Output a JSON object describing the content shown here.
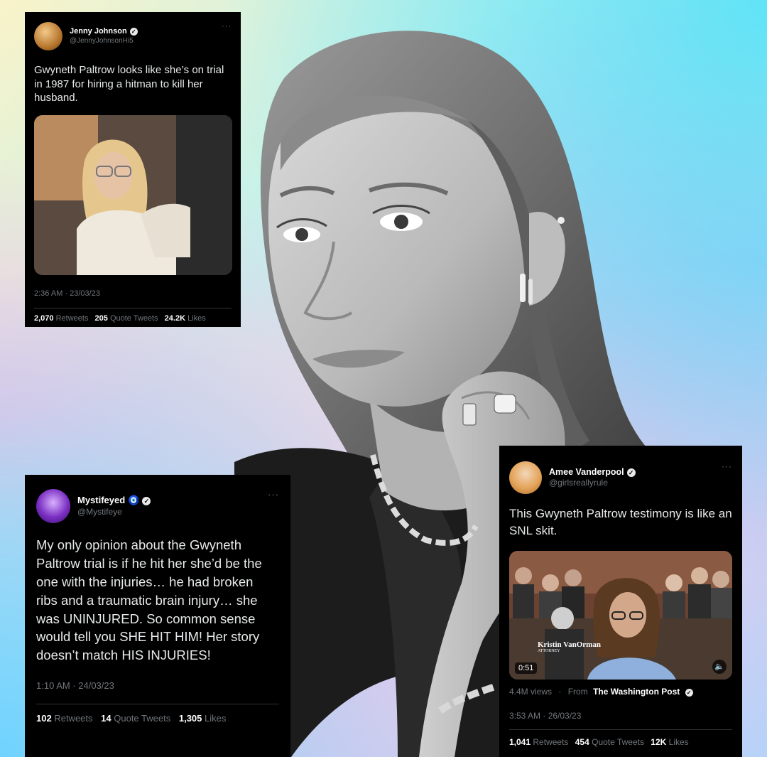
{
  "tweets": [
    {
      "name": "Jenny Johnson",
      "handle": "@JennyJohnsonHi5",
      "text": "Gwyneth Paltrow looks like she’s on trial in 1987 for hiring a hitman to kill her husband.",
      "timestamp": "2:36 AM · 23/03/23",
      "retweets": "2,070",
      "retweets_label": "Retweets",
      "quotes": "205",
      "quotes_label": "Quote Tweets",
      "likes": "24.2K",
      "likes_label": "Likes",
      "more": "···"
    },
    {
      "name": "Mystifeyed",
      "name_emoji": "🧿",
      "handle": "@Mystifeye",
      "text": "My only opinion about the Gwyneth Paltrow trial is if he hit her she’d be the one with the injuries… he had broken ribs and a traumatic brain injury… she was UNINJURED. So common sense would tell you SHE HIT HIM! Her story doesn’t match HIS INJURIES!",
      "timestamp": "1:10 AM · 24/03/23",
      "retweets": "102",
      "retweets_label": "Retweets",
      "quotes": "14",
      "quotes_label": "Quote Tweets",
      "likes": "1,305",
      "likes_label": "Likes",
      "more": "···"
    },
    {
      "name": "Amee Vanderpool",
      "handle": "@girlsreallyrule",
      "text": "This Gwyneth Paltrow testimony is like an SNL skit.",
      "video_time": "0:51",
      "video_caption_name": "Kristin VanOrman",
      "video_caption_role": "ATTORNEY",
      "views": "4.4M views",
      "from_label": "From",
      "from_source": "The Washington Post",
      "timestamp": "3:53 AM · 26/03/23",
      "retweets": "1,041",
      "retweets_label": "Retweets",
      "quotes": "454",
      "quotes_label": "Quote Tweets",
      "likes": "12K",
      "likes_label": "Likes",
      "more": "···"
    }
  ],
  "colors": {
    "twitter_blue": "#1d9bf0",
    "card_bg": "#000000",
    "muted": "#71767b"
  }
}
